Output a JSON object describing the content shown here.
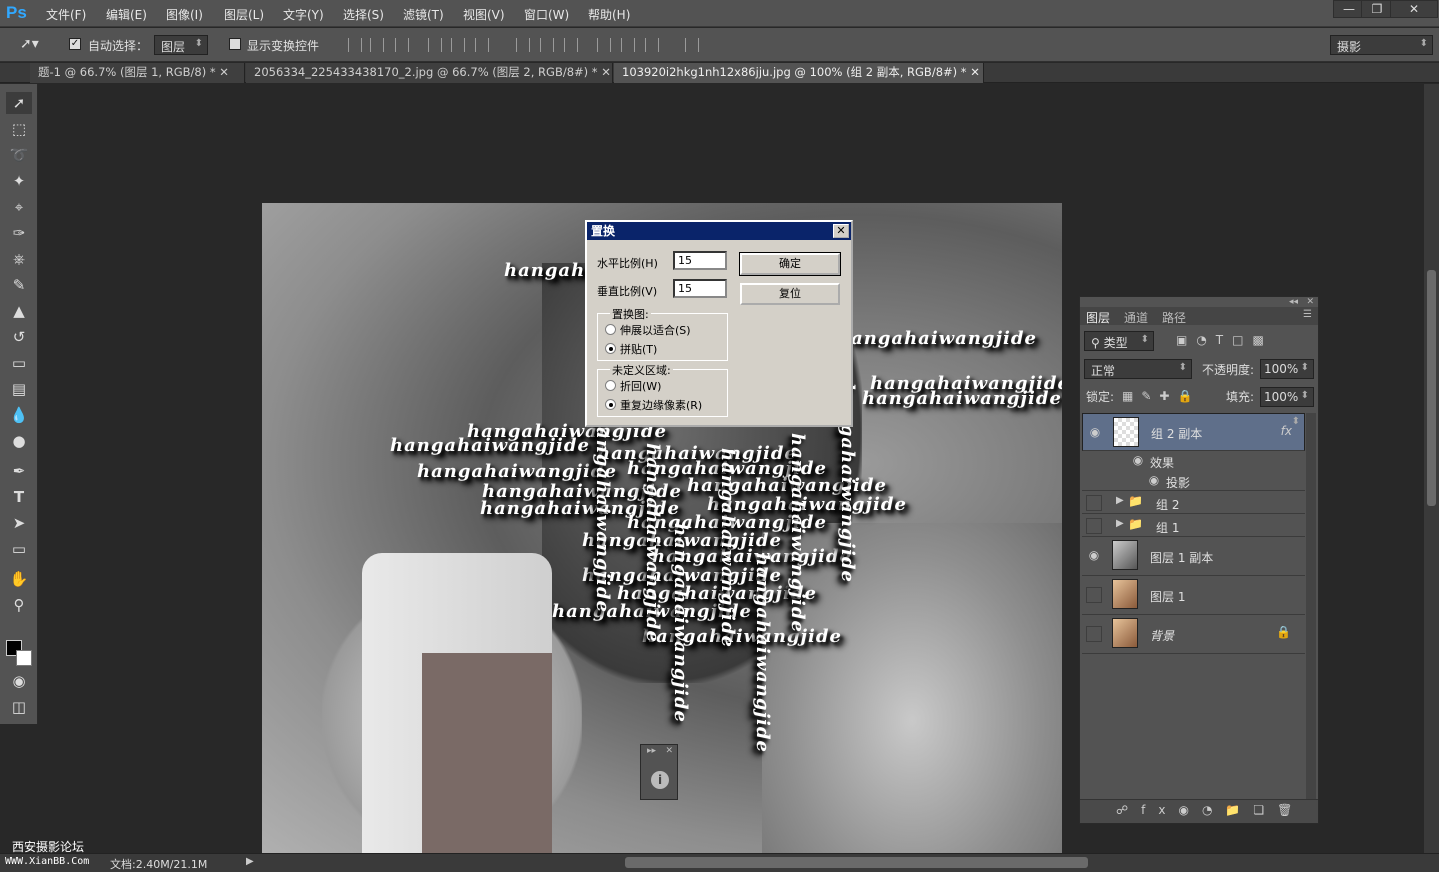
{
  "menubar": {
    "logo": "Ps",
    "items": [
      "文件(F)",
      "编辑(E)",
      "图像(I)",
      "图层(L)",
      "文字(Y)",
      "选择(S)",
      "滤镜(T)",
      "视图(V)",
      "窗口(W)",
      "帮助(H)"
    ]
  },
  "optionsbar": {
    "auto_select_label": "自动选择：",
    "auto_select_target": "图层",
    "show_transform_label": "显示变换控件",
    "workspace": "摄影"
  },
  "tabs": [
    {
      "label": "题-1 @ 66.7% (图层 1, RGB/8) *"
    },
    {
      "label": "2056334_225433438170_2.jpg @ 66.7% (图层 2, RGB/8#) *"
    },
    {
      "label": "103920i2hkg1nh12x86jju.jpg @ 100% (组 2 副本, RGB/8#) *"
    }
  ],
  "watermark_text": "hangahaiwangjide",
  "dialog": {
    "title": "置换",
    "h_scale_label": "水平比例(H)",
    "h_scale_value": "15",
    "v_scale_label": "垂直比例(V)",
    "v_scale_value": "15",
    "ok_label": "确定",
    "reset_label": "复位",
    "map_group": "置换图:",
    "stretch_label": "伸展以适合(S)",
    "tile_label": "拼贴(T)",
    "undefined_group": "未定义区域:",
    "wrap_label": "折回(W)",
    "repeat_label": "重复边缘像素(R)"
  },
  "layers_panel": {
    "tabs": [
      "图层",
      "通道",
      "路径"
    ],
    "filter_kind": "类型",
    "blend_mode": "正常",
    "opacity_label": "不透明度:",
    "opacity_value": "100%",
    "lock_label": "锁定:",
    "fill_label": "填充:",
    "fill_value": "100%",
    "layers": [
      {
        "name": "组 2 副本",
        "visible": true,
        "selected": true
      },
      {
        "name": "效果",
        "visible": true
      },
      {
        "name": "投影",
        "visible": true
      },
      {
        "name": "组 2",
        "visible": false
      },
      {
        "name": "组 1",
        "visible": false
      },
      {
        "name": "图层 1 副本",
        "visible": true
      },
      {
        "name": "图层 1",
        "visible": false
      },
      {
        "name": "背景",
        "visible": false
      }
    ]
  },
  "status": {
    "doc_size": "文档:2.40M/21.1M",
    "forum": "西安摄影论坛",
    "site": "WWW.XianBB.Com"
  },
  "colors": {
    "accent": "#31a8ff",
    "dialog_title": "#0a246a",
    "selected_layer": "#5f6f8a"
  }
}
